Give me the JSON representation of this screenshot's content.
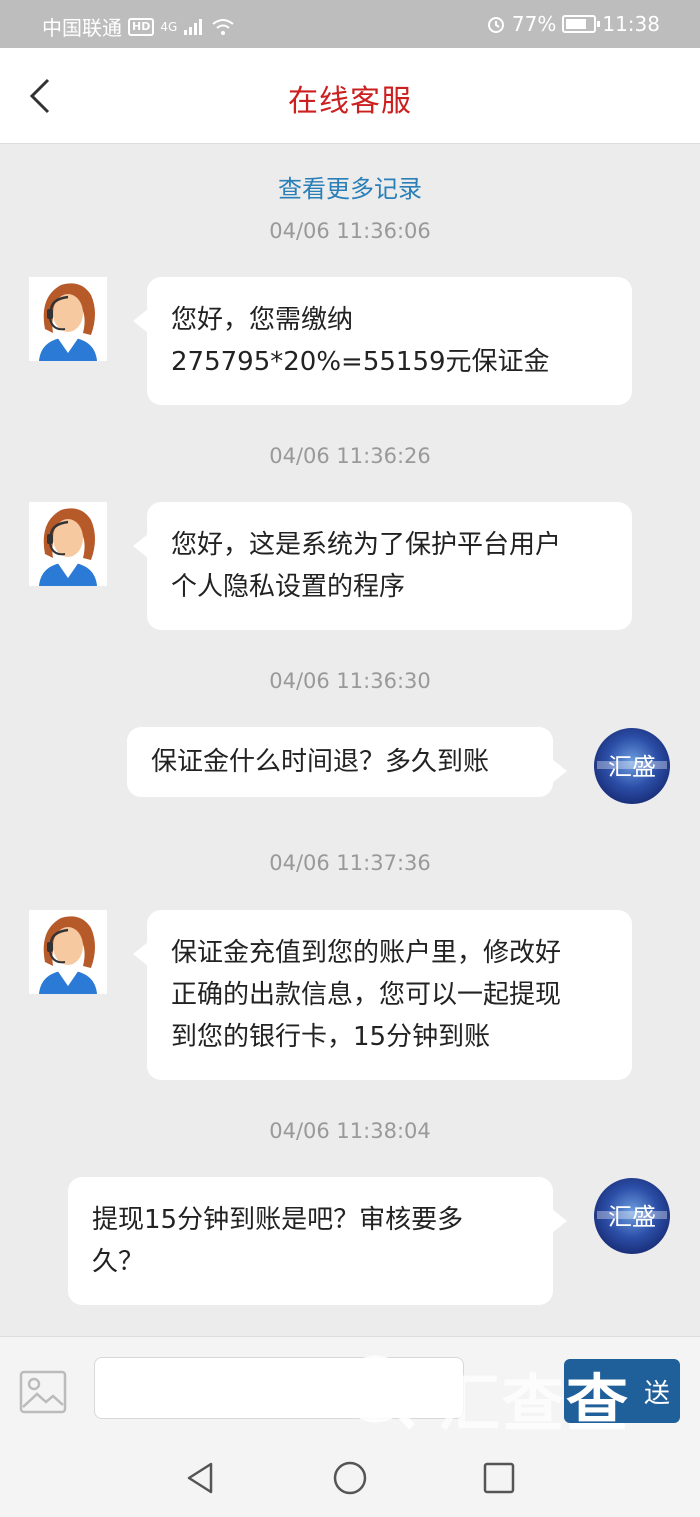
{
  "status_bar": {
    "carrier": "中国联通",
    "hd": "HD",
    "network": "4G",
    "battery": "77%",
    "battery_level": 0.77,
    "time": "11:38"
  },
  "header": {
    "title": "在线客服"
  },
  "chat": {
    "load_more": "查看更多记录",
    "messages": [
      {
        "timestamp": "04/06 11:36:06",
        "sender": "agent",
        "lines": [
          "您好，您需缴纳",
          "275795*20%=55159元保证金"
        ]
      },
      {
        "timestamp": "04/06 11:36:26",
        "sender": "agent",
        "lines": [
          "您好，这是系统为了保护平台用户",
          "个人隐私设置的程序"
        ]
      },
      {
        "timestamp": "04/06 11:36:30",
        "sender": "user",
        "lines": [
          "保证金什么时间退？多久到账"
        ]
      },
      {
        "timestamp": "04/06 11:37:36",
        "sender": "agent",
        "lines": [
          "保证金充值到您的账户里，修改好",
          "正确的出款信息，您可以一起提现",
          "到您的银行卡，15分钟到账"
        ]
      },
      {
        "timestamp": "04/06 11:38:04",
        "sender": "user",
        "lines": [
          "提现15分钟到账是吧？审核要多",
          "久？"
        ]
      }
    ],
    "user_avatar_text": "汇盛"
  },
  "input_bar": {
    "input_value": "",
    "send_label": "送",
    "watermark_text": "汇",
    "watermark_strong": "查",
    "watermark_mid": "查"
  },
  "colors": {
    "title_red": "#cc1f1f",
    "link_blue": "#2a7fb8",
    "send_blue": "#1f5f9a",
    "chat_bg": "#ececec"
  },
  "icons": {
    "back": "chevron-left-icon",
    "image": "image-icon",
    "nav_back": "triangle-back-icon",
    "nav_home": "circle-home-icon",
    "nav_recent": "square-recent-icon"
  }
}
